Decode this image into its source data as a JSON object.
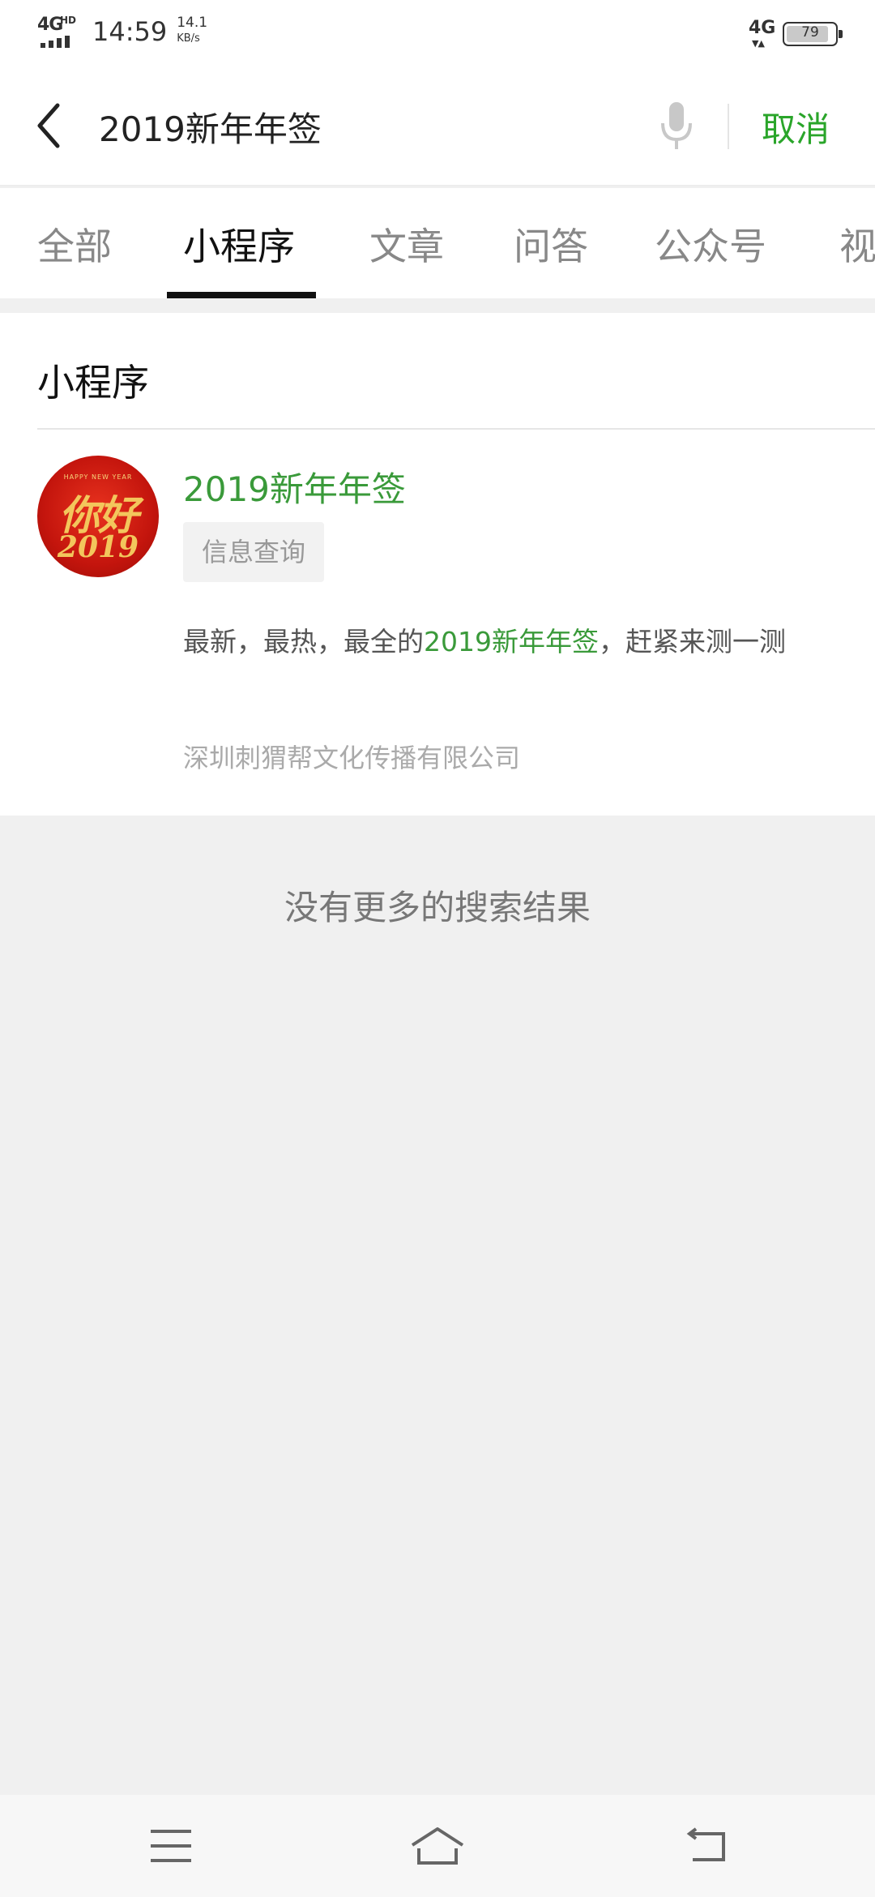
{
  "status_bar": {
    "network_left": "4G",
    "network_hd": "HD",
    "time": "14:59",
    "speed_value": "14.1",
    "speed_unit": "KB/s",
    "network_right": "4G",
    "battery_level": "79"
  },
  "search": {
    "query": "2019新年年签",
    "cancel_label": "取消"
  },
  "tabs": [
    {
      "label": "全部"
    },
    {
      "label": "小程序"
    },
    {
      "label": "文章"
    },
    {
      "label": "问答"
    },
    {
      "label": "公众号"
    },
    {
      "label": "视"
    }
  ],
  "active_tab": "小程序",
  "results": {
    "section_title": "小程序",
    "items": [
      {
        "icon_text_small": "HAPPY NEW YEAR",
        "icon_text_big": "你好",
        "icon_text_year": "2019",
        "name": "2019新年年签",
        "tag": "信息查询",
        "desc_before": "最新，最热，最全的",
        "desc_highlight": "2019新年年签",
        "desc_after": "，赶紧来测一测",
        "company": "深圳刺猬帮文化传播有限公司"
      }
    ]
  },
  "footer_text": "没有更多的搜索结果",
  "colors": {
    "accent_green": "#2aa52a",
    "highlight_green": "#3a9a3a",
    "page_background": "#f0f0f0"
  },
  "icons": {
    "back": "chevron-left-icon",
    "mic": "microphone-icon",
    "menu": "menu-icon",
    "home": "home-icon",
    "return": "back-arrow-icon"
  }
}
